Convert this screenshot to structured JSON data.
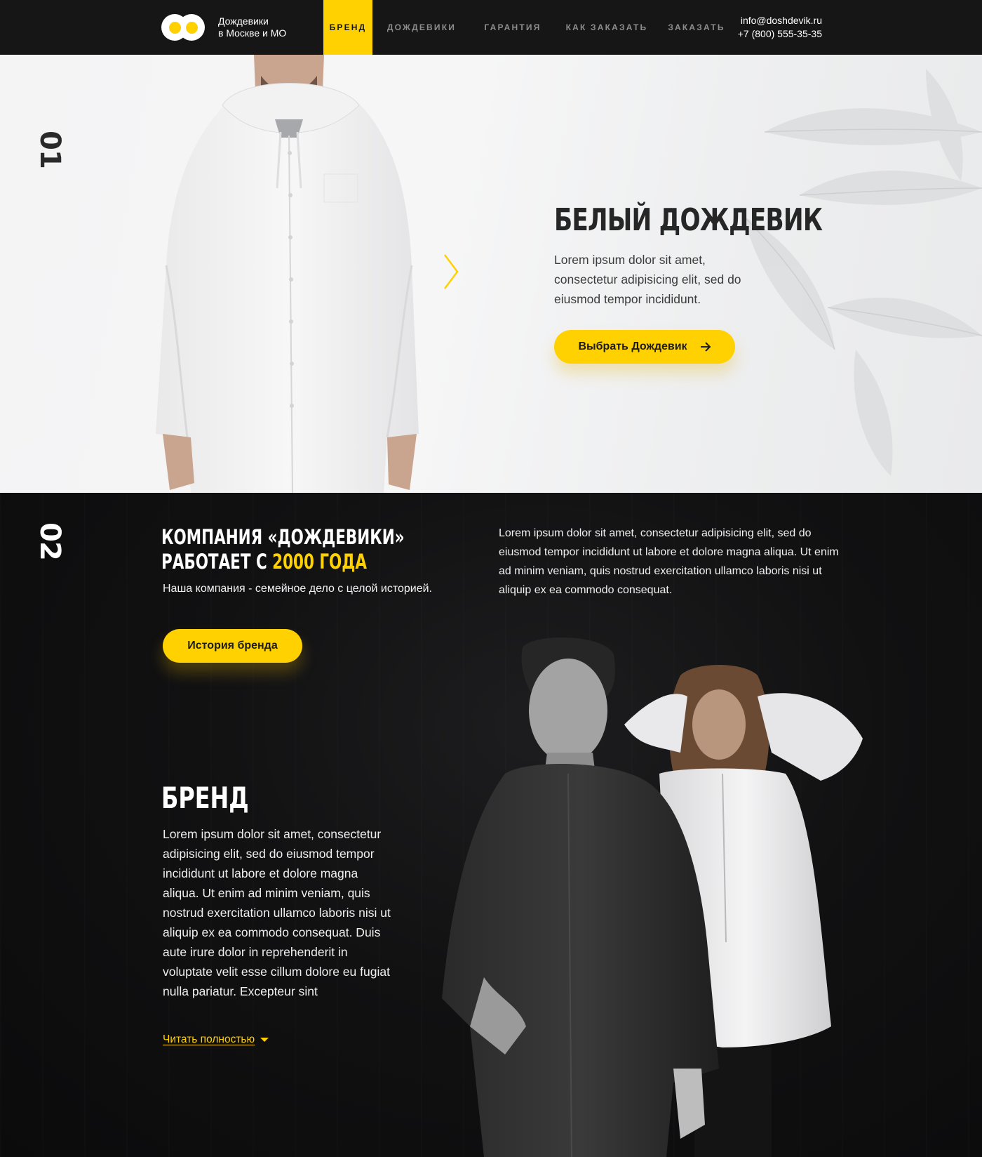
{
  "header": {
    "brand_line1": "Дождевики",
    "brand_line2": "в Москве и МО",
    "nav": [
      "Бренд",
      "Дождевики",
      "Гарантия",
      "Как заказать",
      "Заказать"
    ],
    "email": "info@doshdevik.ru",
    "phone": "+7 (800) 555-35-35"
  },
  "hero": {
    "section_number": "01",
    "title": "Белый дождевик",
    "text": "Lorem ipsum dolor sit amet, consectetur adipisicing elit, sed do eiusmod tempor incididunt.",
    "button_label": "Выбрать Дождевик"
  },
  "about": {
    "section_number": "02",
    "title_line1": "Компания «Дождевики»",
    "title_line2_prefix": "работает с ",
    "title_line2_accent": "2000 года",
    "subtitle": "Наша компания - семейное дело с целой историей.",
    "text": "Lorem ipsum dolor sit amet, consectetur adipisicing elit, sed do eiusmod tempor incididunt ut labore et dolore magna aliqua. Ut enim ad minim veniam, quis nostrud exercitation ullamco laboris nisi ut aliquip ex ea commodo consequat.",
    "history_button": "История бренда",
    "brand_title": "Бренд",
    "brand_text": "Lorem ipsum dolor sit amet, consectetur adipisicing elit, sed do eiusmod tempor incididunt ut labore et dolore magna aliqua. Ut enim ad minim veniam, quis nostrud exercitation ullamco laboris nisi ut aliquip ex ea commodo consequat. Duis aute irure dolor in reprehenderit in voluptate velit esse cillum dolore eu fugiat nulla pariatur. Excepteur sint",
    "read_more": "Читать полностью"
  },
  "colors": {
    "accent": "#ffd100",
    "header_bg": "#161616",
    "dark_bg": "#0c0c0c"
  }
}
